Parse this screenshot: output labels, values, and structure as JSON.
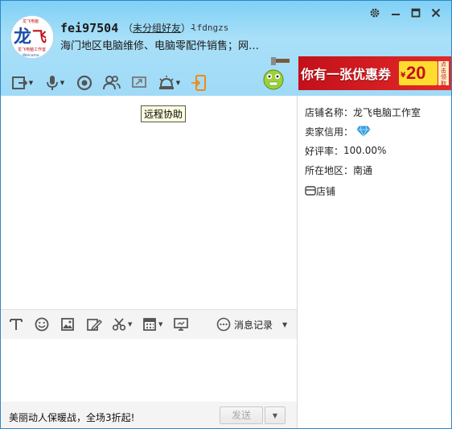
{
  "header": {
    "nickname": "fei97504",
    "group_open": "（",
    "group_label": "未分组好友",
    "group_close": "）-",
    "sub_account": "lfdngzs",
    "status_text": "海门地区电脑维修、电脑零配件销售；网…"
  },
  "avatar": {
    "main_char": "龙",
    "second_char": "飞",
    "caption": "龙飞电脑工作室",
    "small_top": "龙飞电脑",
    "small_bottom": "Welcome"
  },
  "ad": {
    "text": "你有一张优惠券",
    "yen": "¥",
    "amount": "20",
    "side": "点击领取"
  },
  "chat": {
    "tooltip": "远程协助"
  },
  "input_toolbar": {
    "history_label": "消息记录"
  },
  "footer": {
    "promo": "美丽动人保暖战，全场3折起!",
    "send_label": "发送"
  },
  "shop": {
    "name_label": "店铺名称：",
    "name_value": "龙飞电脑工作室",
    "credit_label": "卖家信用：",
    "rating_label": "好评率：",
    "rating_value": "100.00%",
    "region_label": "所在地区：",
    "region_value": "南通",
    "shop_link": "店铺"
  },
  "colors": {
    "header_top": "#7fd0f5",
    "ad_red": "#c3101a",
    "coupon_yellow": "#ffdc2e",
    "diamond_blue": "#3aa6e8",
    "icon_gray": "#555555"
  }
}
